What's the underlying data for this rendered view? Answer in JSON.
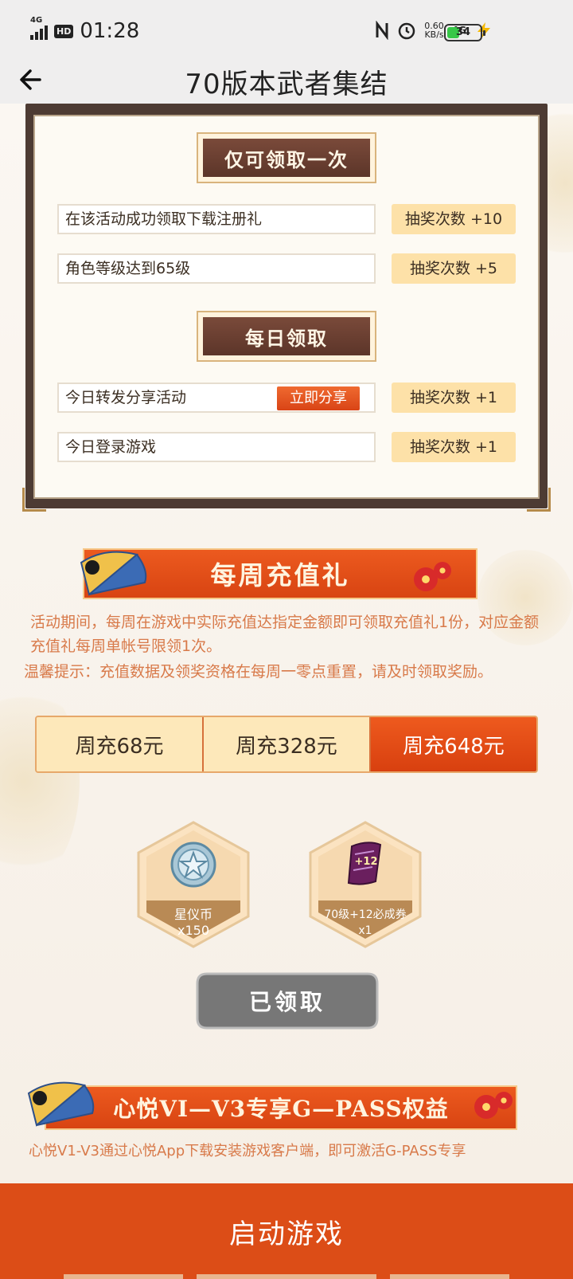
{
  "status_bar": {
    "network": "4G",
    "hd": "HD",
    "time": "01:28",
    "speed_value": "0.60",
    "speed_unit": "KB/s",
    "network2": "4G",
    "battery": "34"
  },
  "header": {
    "title": "70版本武者集结"
  },
  "task_panel": {
    "once_title": "仅可领取一次",
    "once_tasks": [
      {
        "label": "在该活动成功领取下载注册礼",
        "reward": "抽奖次数 +10"
      },
      {
        "label": "角色等级达到65级",
        "reward": "抽奖次数 +5"
      }
    ],
    "daily_title": "每日领取",
    "daily_tasks": [
      {
        "label": "今日转发分享活动",
        "action": "立即分享",
        "reward": "抽奖次数 +1"
      },
      {
        "label": "今日登录游戏",
        "reward": "抽奖次数 +1"
      }
    ]
  },
  "weekly": {
    "title": "每周充值礼",
    "desc": "活动期间，每周在游戏中实际充值达指定金额即可领取充值礼1份，对应金额充值礼每周单帐号限领1次。",
    "tip": "温馨提示：充值数据及领奖资格在每周一零点重置，请及时领取奖励。",
    "tabs": [
      "周充68元",
      "周充328元",
      "周充648元"
    ],
    "active_tab": 2,
    "rewards": [
      {
        "name": "星仪币",
        "qty": "x150",
        "icon": "star-coin-icon"
      },
      {
        "name": "70级+12必成券",
        "qty": "x1",
        "icon": "scroll-ticket-icon",
        "badge": "+12"
      }
    ],
    "claim_button": "已领取"
  },
  "gpass": {
    "title": "心悦VI—V3专享G—PASS权益",
    "desc_partial": "心悦V1-V3通过心悦App下载安装游戏客户端，即可激活G-PASS专享"
  },
  "bottom": {
    "start_button": "启动游戏"
  },
  "colors": {
    "accent": "#dc4d17",
    "panel_frame": "#4d3b33",
    "reward_pill": "#fde1a8"
  }
}
